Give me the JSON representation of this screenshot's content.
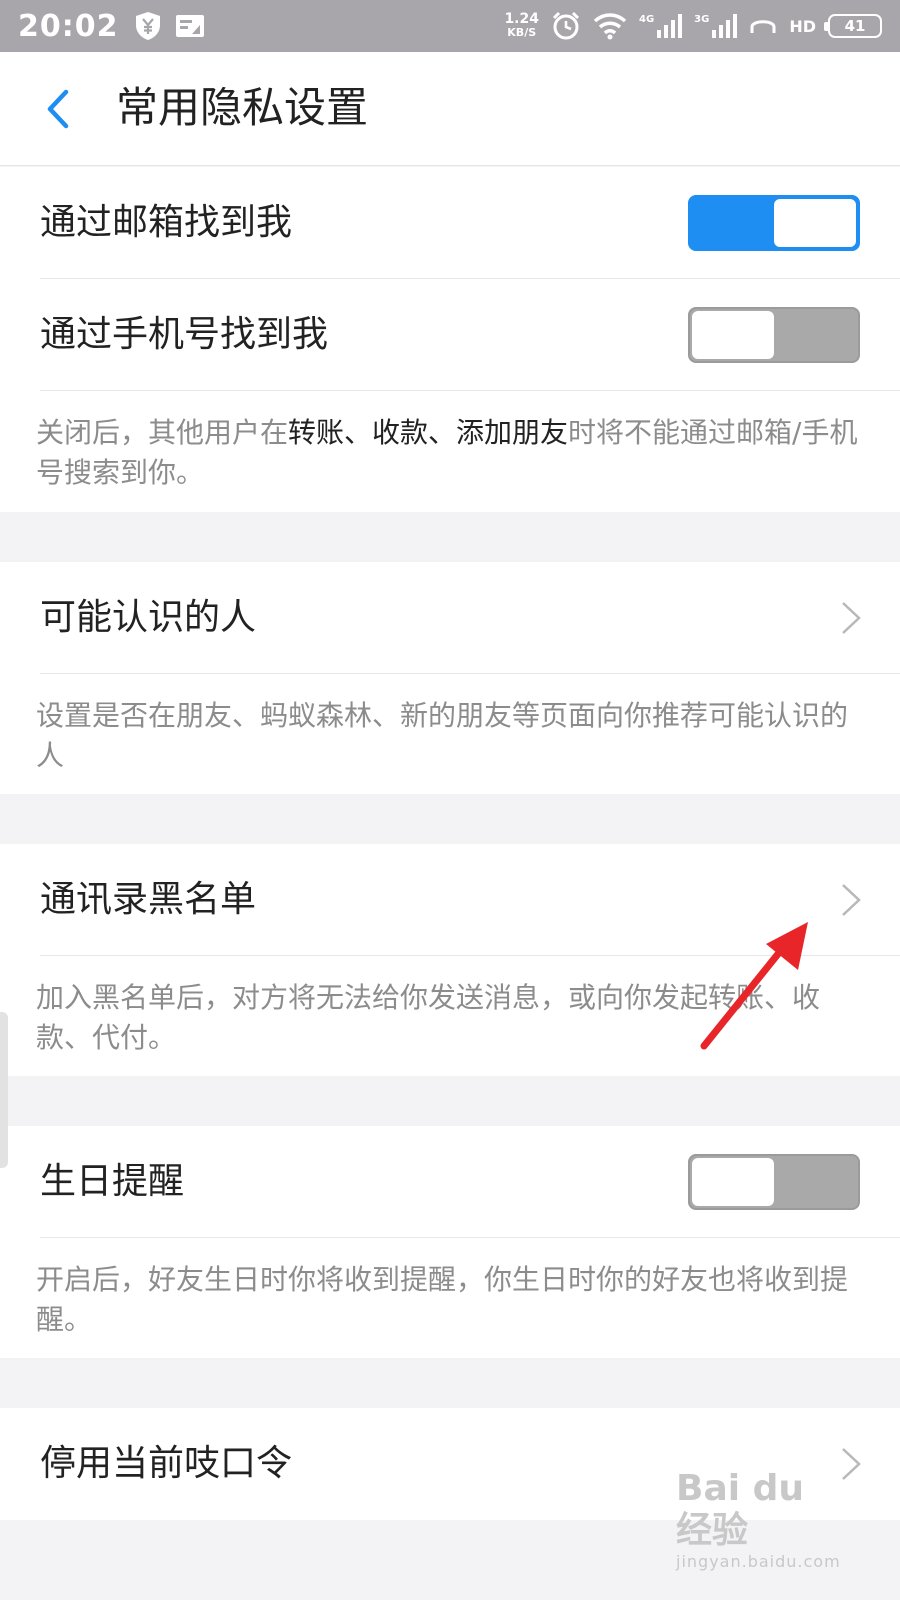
{
  "status_bar": {
    "time": "20:02",
    "speed_value": "1.24",
    "speed_unit": "KB/S",
    "net1": "4G",
    "net2": "3G",
    "hd": "HD",
    "battery": "41"
  },
  "header": {
    "title": "常用隐私设置"
  },
  "section1": {
    "email_label": "通过邮箱找到我",
    "email_on": true,
    "phone_label": "通过手机号找到我",
    "phone_on": false,
    "desc_pre": "关闭后，其他用户在",
    "desc_em": "转账、收款、添加朋友",
    "desc_post": "时将不能通过邮箱/手机号搜索到你。"
  },
  "section2": {
    "label": "可能认识的人",
    "desc": "设置是否在朋友、蚂蚁森林、新的朋友等页面向你推荐可能认识的人"
  },
  "section3": {
    "label": "通讯录黑名单",
    "desc": "加入黑名单后，对方将无法给你发送消息，或向你发起转账、收款、代付。"
  },
  "section4": {
    "label": "生日提醒",
    "on": false,
    "desc": "开启后，好友生日时你将收到提醒，你生日时你的好友也将收到提醒。"
  },
  "section5": {
    "label": "停用当前吱口令"
  },
  "watermark": {
    "main": "Bai du 经验",
    "sub": "jingyan.baidu.com"
  },
  "colors": {
    "accent": "#1e8ef2",
    "arrow": "#e8262a"
  }
}
